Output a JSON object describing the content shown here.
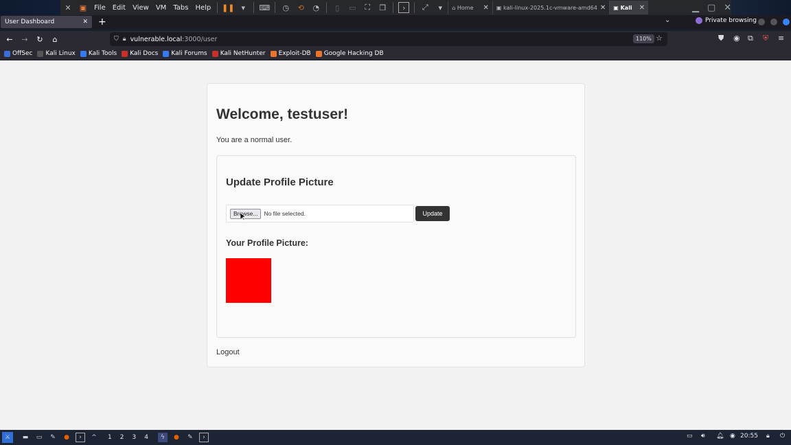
{
  "vm": {
    "menu": [
      "File",
      "Edit",
      "View",
      "VM",
      "Tabs",
      "Help"
    ],
    "tabs": [
      {
        "label": "Home",
        "active": false
      },
      {
        "label": "kali-linux-2025.1c-vmware-amd64",
        "active": false
      },
      {
        "label": "Kali",
        "active": true
      }
    ]
  },
  "browser": {
    "tab_title": "User Dashboard",
    "private_label": "Private browsing",
    "url_host": "vulnerable.local",
    "url_path": ":3000/user",
    "zoom": "110%",
    "bookmarks": [
      {
        "label": "OffSec",
        "color": "#3a6fd8"
      },
      {
        "label": "Kali Linux",
        "color": "#222"
      },
      {
        "label": "Kali Tools",
        "color": "#367bf0"
      },
      {
        "label": "Kali Docs",
        "color": "#c9302c"
      },
      {
        "label": "Kali Forums",
        "color": "#367bf0"
      },
      {
        "label": "Kali NetHunter",
        "color": "#c9302c"
      },
      {
        "label": "Exploit-DB",
        "color": "#e8752b"
      },
      {
        "label": "Google Hacking DB",
        "color": "#e8752b"
      }
    ]
  },
  "page": {
    "welcome": "Welcome, testuser!",
    "role_text": "You are a normal user.",
    "upload_title": "Update Profile Picture",
    "browse_label": "Browse...",
    "no_file_label": "No file selected.",
    "update_label": "Update",
    "pic_title": "Your Profile Picture:",
    "pic_color": "#ff0000",
    "logout_label": "Logout"
  },
  "taskbar": {
    "workspaces": [
      "1",
      "2",
      "3",
      "4"
    ],
    "time": "20:55"
  }
}
